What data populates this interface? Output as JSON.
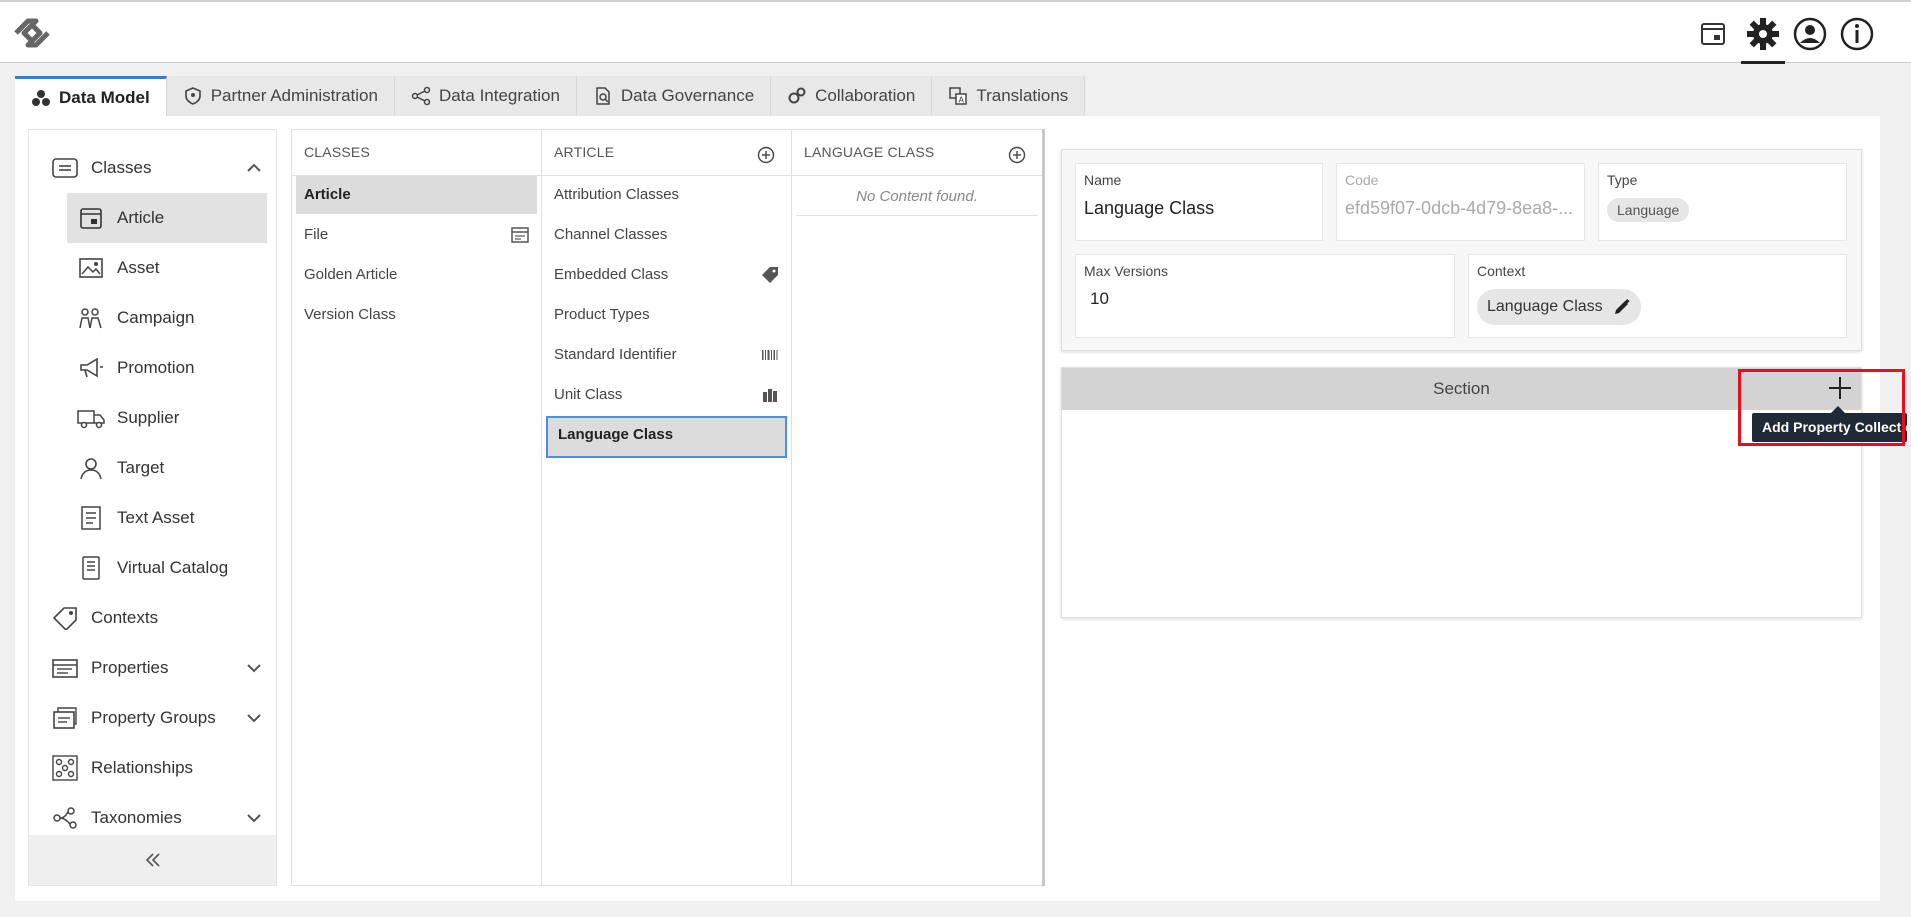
{
  "tabs": [
    {
      "label": "Data Model",
      "icon": "data-model-icon",
      "active": true
    },
    {
      "label": "Partner Administration",
      "icon": "shield-icon",
      "active": false
    },
    {
      "label": "Data Integration",
      "icon": "share-icon",
      "active": false
    },
    {
      "label": "Data Governance",
      "icon": "document-search-icon",
      "active": false
    },
    {
      "label": "Collaboration",
      "icon": "gears-icon",
      "active": false
    },
    {
      "label": "Translations",
      "icon": "translate-icon",
      "active": false
    }
  ],
  "nav": {
    "classes": "Classes",
    "article": "Article",
    "asset": "Asset",
    "campaign": "Campaign",
    "promotion": "Promotion",
    "supplier": "Supplier",
    "target": "Target",
    "text_asset": "Text Asset",
    "virtual_catalog": "Virtual Catalog",
    "contexts": "Contexts",
    "properties": "Properties",
    "property_groups": "Property Groups",
    "relationships": "Relationships",
    "taxonomies": "Taxonomies"
  },
  "columns": {
    "classes": {
      "header": "CLASSES",
      "items": [
        "Article",
        "File",
        "Golden Article",
        "Version Class"
      ]
    },
    "article": {
      "header": "ARTICLE",
      "items": [
        "Attribution Classes",
        "Channel Classes",
        "Embedded Class",
        "Product Types",
        "Standard Identifier",
        "Unit Class",
        "Language Class"
      ]
    },
    "language_class": {
      "header": "LANGUAGE CLASS",
      "empty": "No Content found."
    }
  },
  "detail": {
    "name_label": "Name",
    "name_value": "Language Class",
    "code_label": "Code",
    "code_value": "efd59f07-0dcb-4d79-8ea8-...",
    "type_label": "Type",
    "type_value": "Language",
    "max_versions_label": "Max Versions",
    "max_versions_value": "10",
    "context_label": "Context",
    "context_value": "Language Class"
  },
  "section": {
    "title": "Section",
    "tooltip": "Add Property Collection"
  },
  "colors": {
    "accent": "#3a7bd5",
    "highlight": "#e5101e",
    "tooltip_bg": "#1f2a36"
  }
}
